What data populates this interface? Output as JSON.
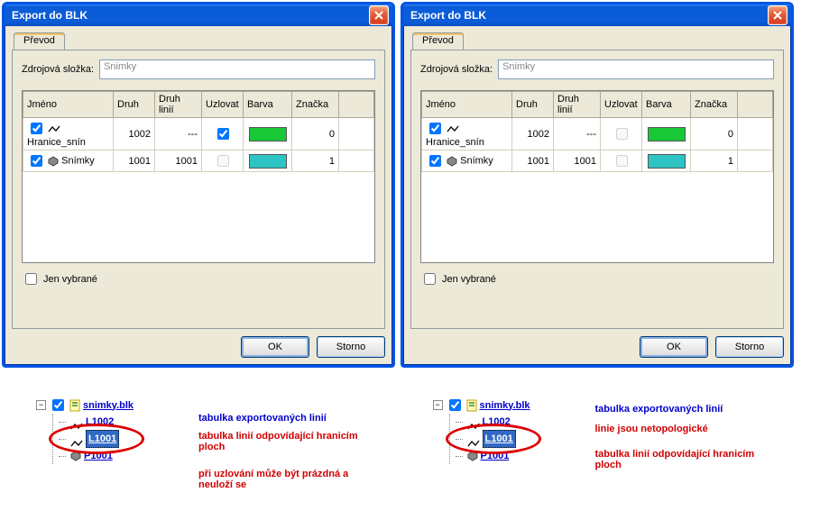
{
  "dialog": {
    "title": "Export do BLK",
    "tab": "Převod",
    "source_label": "Zdrojová složka:",
    "source_value": "Snimky",
    "cols": {
      "name": "Jméno",
      "kind": "Druh",
      "linetype": "Druh linií",
      "node": "Uzlovat",
      "color": "Barva",
      "mark": "Značka"
    },
    "only_selected": "Jen vybrané",
    "ok": "OK",
    "cancel": "Storno"
  },
  "left_rows": [
    {
      "checked": true,
      "name": "Hranice_snín",
      "kind": "1002",
      "linetype": "---",
      "node": true,
      "color": "#19c837",
      "mark": "0"
    },
    {
      "checked": true,
      "name": "Snímky",
      "kind": "1001",
      "linetype": "1001",
      "node": false,
      "color": "#2fc4c4",
      "mark": "1"
    }
  ],
  "right_rows": [
    {
      "checked": true,
      "name": "Hranice_snín",
      "kind": "1002",
      "linetype": "---",
      "node": false,
      "color": "#19c837",
      "mark": "0"
    },
    {
      "checked": true,
      "name": "Snímky",
      "kind": "1001",
      "linetype": "1001",
      "node": false,
      "color": "#2fc4c4",
      "mark": "1"
    }
  ],
  "tree": {
    "root": "snimky.blk",
    "items": [
      "L1002",
      "L1001",
      "P1001"
    ],
    "selected": "L1001"
  },
  "annot_left": {
    "l1": "tabulka exportovaných linií",
    "l2": "tabulka linií odpovídající hranicím ploch",
    "l3": "při uzlování může být prázdná a neuloží se"
  },
  "annot_right": {
    "l1": "tabulka exportovaných linií",
    "l2": "linie jsou netopologické",
    "l3": "tabulka linií odpovídající hranicím ploch"
  }
}
